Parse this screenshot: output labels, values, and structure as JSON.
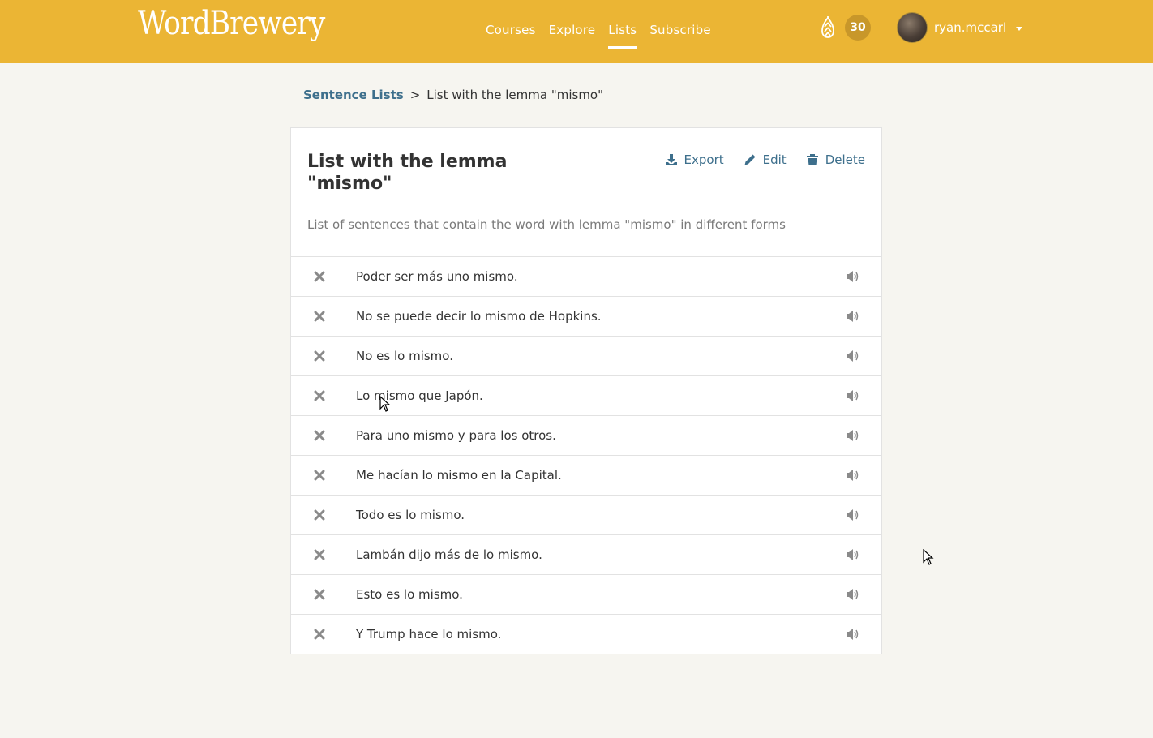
{
  "header": {
    "logo": "WordBrewery",
    "nav": [
      {
        "label": "Courses",
        "active": false
      },
      {
        "label": "Explore",
        "active": false
      },
      {
        "label": "Lists",
        "active": true
      },
      {
        "label": "Subscribe",
        "active": false
      }
    ],
    "points": "30",
    "username": "ryan.mccarl"
  },
  "breadcrumb": {
    "parent": "Sentence Lists",
    "separator": ">",
    "current": "List with the lemma \"mismo\""
  },
  "list": {
    "title": "List with the lemma \"mismo\"",
    "description": "List of sentences that contain the word with lemma \"mismo\" in different forms",
    "actions": {
      "export": "Export",
      "edit": "Edit",
      "delete": "Delete"
    },
    "sentences": [
      "Poder ser más uno mismo.",
      "No se puede decir lo mismo de Hopkins.",
      "No es lo mismo.",
      "Lo mismo que Japón.",
      "Para uno mismo y para los otros.",
      "Me hacían lo mismo en la Capital.",
      "Todo es lo mismo.",
      "Lambán dijo más de lo mismo.",
      "Esto es lo mismo.",
      "Y Trump hace lo mismo."
    ]
  },
  "colors": {
    "header_bg": "#ebb534",
    "link": "#3d6f8c",
    "page_bg": "#f6f5f0"
  }
}
